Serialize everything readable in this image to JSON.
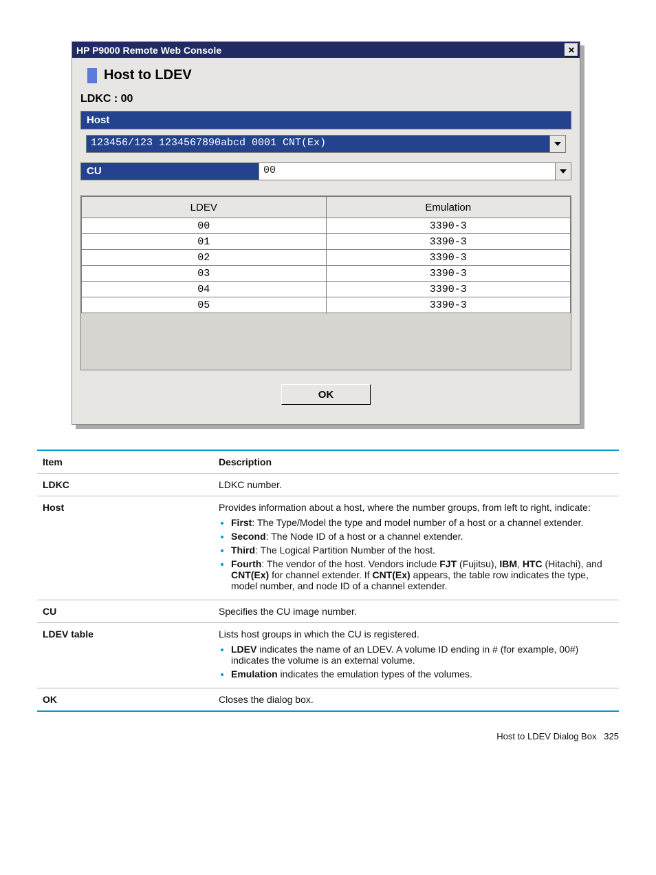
{
  "window": {
    "title": "HP P9000 Remote Web Console",
    "close_glyph": "✕"
  },
  "dialog": {
    "title": "Host to LDEV",
    "ldkc_label": "LDKC : 00",
    "host_section_label": "Host",
    "host_value": "123456/123  1234567890abcd  0001  CNT(Ex)",
    "cu_label": "CU",
    "cu_value": "00",
    "ok_label": "OK",
    "table": {
      "col_ldev": "LDEV",
      "col_emul": "Emulation",
      "rows": [
        {
          "ldev": "00",
          "emul": "3390-3"
        },
        {
          "ldev": "01",
          "emul": "3390-3"
        },
        {
          "ldev": "02",
          "emul": "3390-3"
        },
        {
          "ldev": "03",
          "emul": "3390-3"
        },
        {
          "ldev": "04",
          "emul": "3390-3"
        },
        {
          "ldev": "05",
          "emul": "3390-3"
        }
      ]
    }
  },
  "desc": {
    "col_item": "Item",
    "col_desc": "Description",
    "rows": {
      "ldkc": {
        "item": "LDKC",
        "text": "LDKC number."
      },
      "host": {
        "item": "Host",
        "intro": "Provides information about a host, where the number groups, from left to right, indicate:",
        "b1a": "First",
        "b1b": ": The Type/Model the type and model number of a host or a channel extender.",
        "b2a": "Second",
        "b2b": ": The Node ID of a host or a channel extender.",
        "b3a": "Third",
        "b3b": ": The Logical Partition Number of the host.",
        "b4a": "Fourth",
        "b4b": ": The vendor of the host. Vendors include ",
        "b4c": "FJT",
        "b4d": " (Fujitsu), ",
        "b4e": "IBM",
        "b4f": ", ",
        "b4g": "HTC",
        "b4h": " (Hitachi), and ",
        "b4i": "CNT(Ex)",
        "b4j": " for channel extender. If ",
        "b4k": "CNT(Ex)",
        "b4l": " appears, the table row indicates the type, model number, and node ID of a channel extender."
      },
      "cu": {
        "item": "CU",
        "text": "Specifies the CU image number."
      },
      "ldev_table": {
        "item": "LDEV table",
        "intro": "Lists host groups in which the CU is registered.",
        "b1a": "LDEV",
        "b1b": " indicates the name of an LDEV. A volume ID ending in # (for example, 00#) indicates the volume is an external volume.",
        "b2a": "Emulation",
        "b2b": " indicates the emulation types of the volumes."
      },
      "ok": {
        "item": "OK",
        "text": "Closes the dialog box."
      }
    }
  },
  "footer": {
    "text": "Host to LDEV Dialog Box",
    "page": "325"
  }
}
